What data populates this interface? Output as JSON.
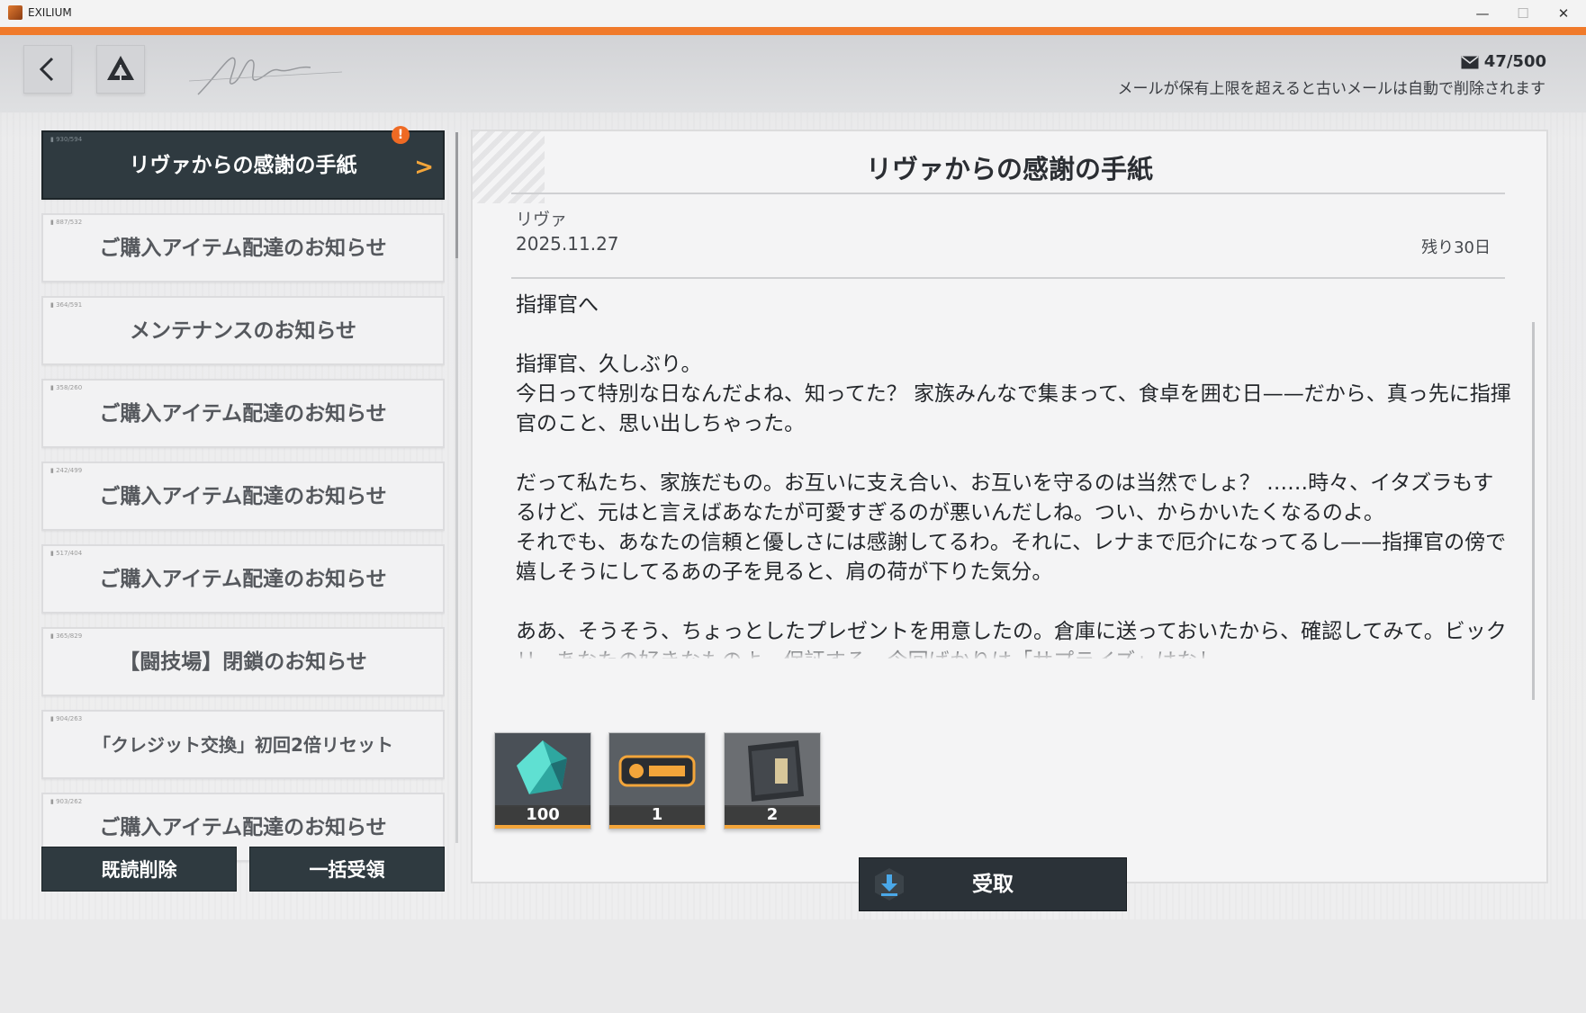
{
  "window": {
    "title": "EXILIUM",
    "minimize": "—",
    "maximize": "☐",
    "close": "✕"
  },
  "header": {
    "mail_count": "47/500",
    "limit_note": "メールが保有上限を超えると古いメールは自動で削除されます"
  },
  "mail_list": [
    {
      "label": "リヴァからの感謝の手紙",
      "selected": true,
      "unread_alert": "!"
    },
    {
      "label": "ご購入アイテム配達のお知らせ"
    },
    {
      "label": "メンテナンスのお知らせ"
    },
    {
      "label": "ご購入アイテム配達のお知らせ"
    },
    {
      "label": "ご購入アイテム配達のお知らせ"
    },
    {
      "label": "ご購入アイテム配達のお知らせ"
    },
    {
      "label": "【闘技場】閉鎖のお知らせ"
    },
    {
      "label": "「クレジット交換」初回2倍リセット"
    },
    {
      "label": "ご購入アイテム配達のお知らせ"
    }
  ],
  "buttons": {
    "delete_read": "既読削除",
    "claim_all": "一括受領",
    "claim": "受取"
  },
  "mail": {
    "title": "リヴァからの感謝の手紙",
    "sender": "リヴァ",
    "date": "2025.11.27",
    "remaining": "残り30日",
    "body": "指揮官へ\n\n指揮官、久しぶり。\n今日って特別な日なんだよね、知ってた？ 家族みんなで集まって、食卓を囲む日——だから、真っ先に指揮官のこと、思い出しちゃった。\n\nだって私たち、家族だもの。お互いに支え合い、お互いを守るのは当然でしょ？ ……時々、イタズラもするけど、元はと言えばあなたが可愛すぎるのが悪いんだしね。つい、からかいたくなるのよ。\nそれでも、あなたの信頼と優しさには感謝してるわ。それに、レナまで厄介になってるし——指揮官の傍で嬉しそうにしてるあの子を見ると、肩の荷が下りた気分。\n\nああ、そうそう、ちょっとしたプレゼントを用意したの。倉庫に送っておいたから、確認してみて。ビックリ、あなたの好きなものよ。保証する。今回ばかりは「サプライズ」はなし"
  },
  "rewards": [
    {
      "name": "crystal",
      "qty": "100"
    },
    {
      "name": "ticket",
      "qty": "1"
    },
    {
      "name": "supply-pack",
      "qty": "2"
    }
  ]
}
